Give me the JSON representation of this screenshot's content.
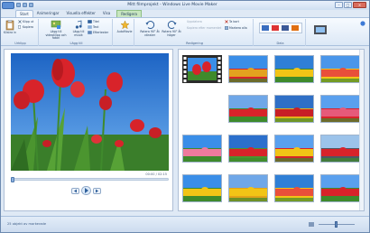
{
  "window": {
    "title": "Mitt filmprojekt - Windows Live Movie Maker",
    "controls": [
      "–",
      "□",
      "×"
    ]
  },
  "tabs": [
    {
      "label": "Start",
      "active": true
    },
    {
      "label": "Animeringar",
      "active": false
    },
    {
      "label": "Visuella effekter",
      "active": false
    },
    {
      "label": "Visa",
      "active": false
    },
    {
      "label": "Redigera",
      "active": false,
      "context_label": "Videoverktyg"
    }
  ],
  "ribbon": {
    "clipboard": {
      "label": "Urklipp",
      "paste": "Klistra in",
      "cut": "Klipp ut",
      "copy": "Kopiera"
    },
    "add": {
      "label": "Lägg till",
      "add_video": "Lägg till videoklipp och foton",
      "add_music": "Lägg till musik",
      "title": "Titel",
      "caption": "Text",
      "credits": "Eftertexter"
    },
    "automovie": {
      "label": "AutoMovie"
    },
    "editing": {
      "label": "Redigering",
      "rotate_left": "Rotera 90° åt vänster",
      "rotate_right": "Rotera 90° åt höger",
      "delete": "Ta bort",
      "select_all": "Markera alla",
      "disabled_1": "Uppdatera",
      "disabled_2": "Kopiera efter momentet"
    },
    "sharing": {
      "label": "Dela"
    }
  },
  "preview": {
    "timecode": "00:00 / 02:15",
    "image": "red-tulips-field"
  },
  "storyboard": {
    "rows": [
      [
        "filmstrip",
        "tulip-field-wide",
        "yellow-tulips",
        "tulip-field-sky"
      ],
      [
        "blank",
        "red-tulip-rows",
        "red-tulip-field",
        "pink-tulip-field"
      ],
      [
        "pink-tulip-closeup",
        "red-tulips-sky",
        "tulip-field-blue",
        "tulip-windmill"
      ],
      [
        "yellow-tulips-closeup",
        "yellow-tulip-rows",
        "tulip-sky-mixed",
        "red-tulips-closeup"
      ]
    ]
  },
  "status": {
    "text": "25 objekt av markerade"
  },
  "colors": {
    "accent": "#5b8fd6",
    "ribbon_bg": "#dce8f6",
    "sky": "#3a7fd6",
    "tulip_red": "#d8232a",
    "tulip_yellow": "#f2c416",
    "leaf": "#3f8a2c"
  }
}
